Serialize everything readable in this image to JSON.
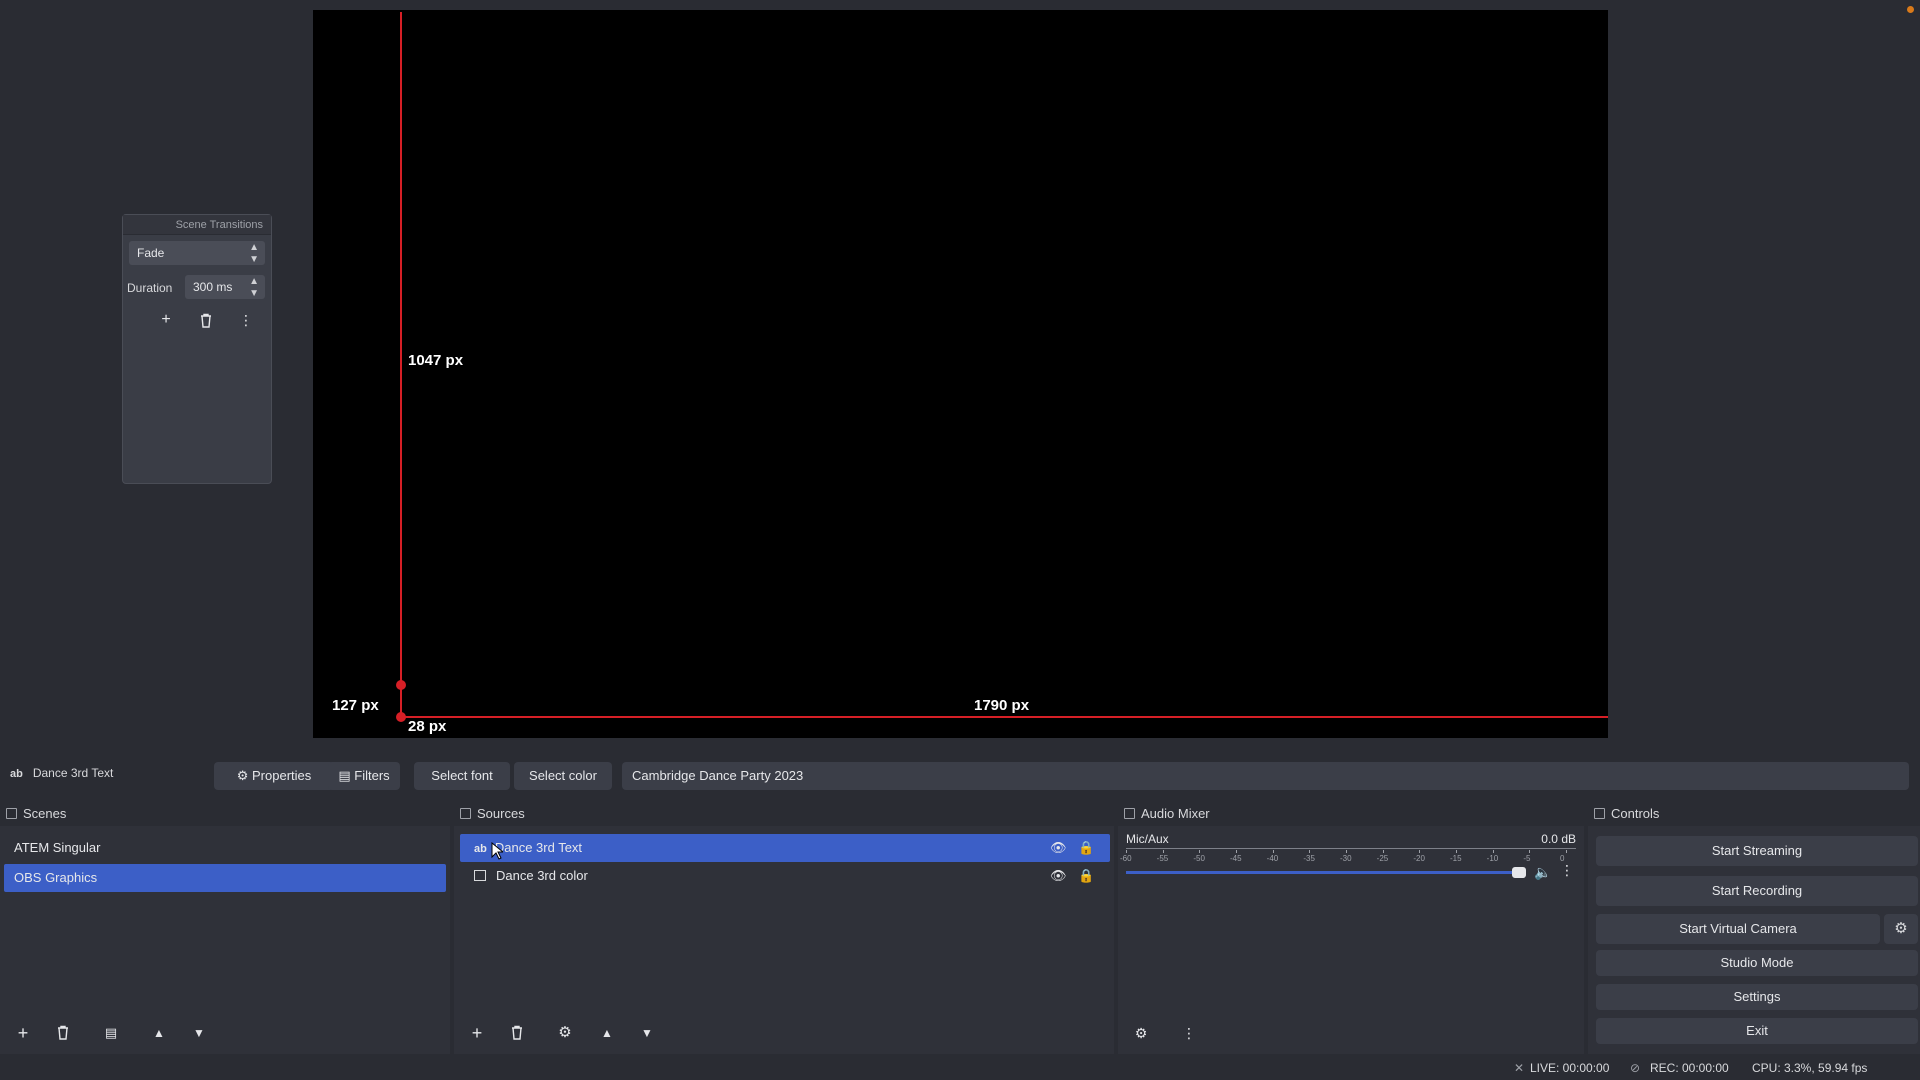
{
  "preview": {
    "measure_top": "1047 px",
    "measure_left": "127 px",
    "measure_bottom": "28 px",
    "measure_right": "1790 px"
  },
  "transitions": {
    "title": "Scene Transitions",
    "selected": "Fade",
    "duration_label": "Duration",
    "duration_value": "300 ms"
  },
  "context_bar": {
    "source_type": "ab",
    "source_name": "Dance 3rd Text",
    "properties": "Properties",
    "filters": "Filters",
    "select_font": "Select font",
    "select_color": "Select color",
    "text_value": "Cambridge Dance Party 2023"
  },
  "scenes": {
    "title": "Scenes",
    "items": [
      "ATEM Singular",
      "OBS Graphics"
    ],
    "selected_index": 1
  },
  "sources": {
    "title": "Sources",
    "items": [
      {
        "name": "Dance 3rd Text",
        "type_icon": "ab"
      },
      {
        "name": "Dance 3rd color",
        "type_icon": "image-icon"
      }
    ]
  },
  "audio": {
    "title": "Audio Mixer",
    "channel": "Mic/Aux",
    "level": "0.0 dB",
    "meter_ticks": [
      "-60",
      "-55",
      "-50",
      "-45",
      "-40",
      "-35",
      "-30",
      "-25",
      "-20",
      "-15",
      "-10",
      "-5",
      "0"
    ],
    "volume_fraction": 1.0
  },
  "controls": {
    "title": "Controls",
    "start_streaming": "Start Streaming",
    "start_recording": "Start Recording",
    "start_virtual_camera": "Start Virtual Camera",
    "studio_mode": "Studio Mode",
    "settings": "Settings",
    "exit": "Exit"
  },
  "status": {
    "live": "LIVE: 00:00:00",
    "rec": "REC: 00:00:00",
    "cpu": "CPU: 3.3%, 59.94 fps"
  },
  "colors": {
    "guide": "#d61f26",
    "selection": "#3c5fc7",
    "muted": "#d61f26"
  }
}
